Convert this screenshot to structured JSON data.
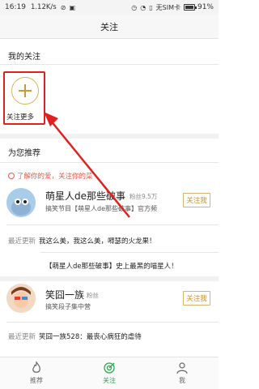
{
  "status_bar": {
    "time": "16:19",
    "speed": "1.12K/s",
    "sim": "无SIM卡",
    "battery": "91%"
  },
  "header": {
    "title": "关注"
  },
  "my_follows": {
    "heading": "我的关注",
    "more_label": "关注更多"
  },
  "recommend": {
    "heading": "为您推荐",
    "tip": "了解你的爱，关注你的菜",
    "cards": [
      {
        "name": "萌星人de那些破事",
        "fans": "粉丝9.5万",
        "desc": "搞笑节目【萌星人de那些破事】官方频",
        "follow_label": "关注我",
        "recent_tag": "最近更新",
        "updates": [
          "我这么美，我这么美，嘚瑟的火龙果！",
          "【萌星人de那些破事】史上最黑的喵星人！"
        ]
      },
      {
        "name": "笑囧一族",
        "fans": "粉丝",
        "desc": "搞笑段子集中营",
        "follow_label": "关注我",
        "recent_tag": "最近更新",
        "updates": [
          "笑囧一族528：最丧心病狂的虐待"
        ]
      }
    ]
  },
  "tabs": [
    {
      "label": "推荐",
      "icon": "flame-icon"
    },
    {
      "label": "关注",
      "icon": "target-icon",
      "active": true
    },
    {
      "label": "我",
      "icon": "user-icon"
    }
  ],
  "colors": {
    "accent_green": "#2fa84f",
    "highlight_red": "#e0201e",
    "follow_gold": "#c8912c"
  }
}
